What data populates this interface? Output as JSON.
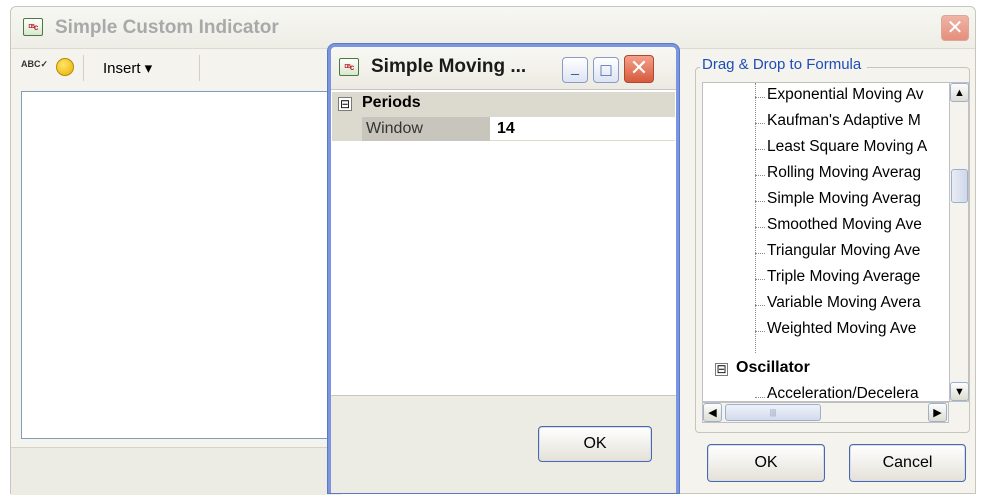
{
  "main_window": {
    "title": "Simple Custom Indicator",
    "app_icon": "formula-doc-icon",
    "icon_text": "ᴰᴮc",
    "toolbar": {
      "spellcheck_icon": "spellcheck-icon",
      "spellcheck_text": "ABC✓",
      "smiley_icon": "smiley-icon",
      "insert_label": "Insert ▾"
    },
    "close_glyph": "✕"
  },
  "child_dialog": {
    "title": "Simple Moving ...",
    "minimize_glyph": "_",
    "maximize_glyph": "□",
    "close_glyph": "✕",
    "category": {
      "toggle": "⊟",
      "label": "Periods"
    },
    "property": {
      "name": "Window",
      "value": "14"
    },
    "ok_label": "OK"
  },
  "formula_panel": {
    "group_label": "Drag & Drop to Formula",
    "items": [
      "Exponential Moving Av",
      "Kaufman's Adaptive M",
      "Least Square Moving A",
      "Rolling Moving Averag",
      "Simple Moving Averag",
      "Smoothed Moving Ave",
      "Triangular Moving Ave",
      "Triple Moving Average",
      "Variable Moving Avera",
      "Weighted Moving Ave"
    ],
    "oscillator": {
      "toggle": "⊟",
      "label": "Oscillator"
    },
    "oscillator_items": [
      "Acceleration/Decelera"
    ],
    "scroll_glyphs": {
      "up": "▲",
      "down": "▼",
      "left": "◀",
      "right": "▶",
      "grip": "|||"
    }
  },
  "footer": {
    "ok_label": "OK",
    "cancel_label": "Cancel"
  }
}
